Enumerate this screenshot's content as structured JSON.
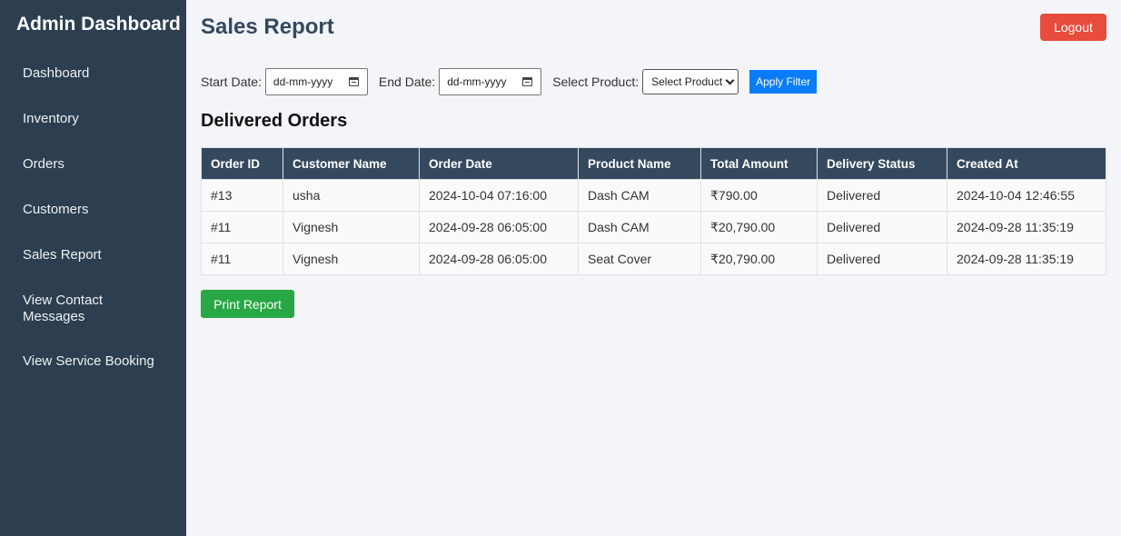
{
  "sidebar": {
    "title": "Admin Dashboard",
    "items": [
      {
        "label": "Dashboard"
      },
      {
        "label": "Inventory"
      },
      {
        "label": "Orders"
      },
      {
        "label": "Customers"
      },
      {
        "label": "Sales Report"
      },
      {
        "label": "View Contact Messages"
      },
      {
        "label": "View Service Booking"
      }
    ]
  },
  "header": {
    "title": "Sales Report",
    "logout_label": "Logout"
  },
  "filters": {
    "start_label": "Start Date:",
    "start_placeholder": "dd-mm-yyyy",
    "end_label": "End Date:",
    "end_placeholder": "dd-mm-yyyy",
    "product_label": "Select Product:",
    "product_selected": "Select Product",
    "apply_label": "Apply Filter"
  },
  "section": {
    "title": "Delivered Orders"
  },
  "table": {
    "columns": [
      "Order ID",
      "Customer Name",
      "Order Date",
      "Product Name",
      "Total Amount",
      "Delivery Status",
      "Created At"
    ],
    "rows": [
      [
        "#13",
        "usha",
        "2024-10-04 07:16:00",
        "Dash CAM",
        "₹790.00",
        "Delivered",
        "2024-10-04 12:46:55"
      ],
      [
        "#11",
        "Vignesh",
        "2024-09-28 06:05:00",
        "Dash CAM",
        "₹20,790.00",
        "Delivered",
        "2024-09-28 11:35:19"
      ],
      [
        "#11",
        "Vignesh",
        "2024-09-28 06:05:00",
        "Seat Cover",
        "₹20,790.00",
        "Delivered",
        "2024-09-28 11:35:19"
      ]
    ]
  },
  "actions": {
    "print_label": "Print Report"
  },
  "colors": {
    "sidebar_bg": "#2c3e50",
    "header_row_bg": "#34495e",
    "logout": "#e74c3c",
    "apply": "#0a7cf7",
    "print": "#28a745"
  }
}
